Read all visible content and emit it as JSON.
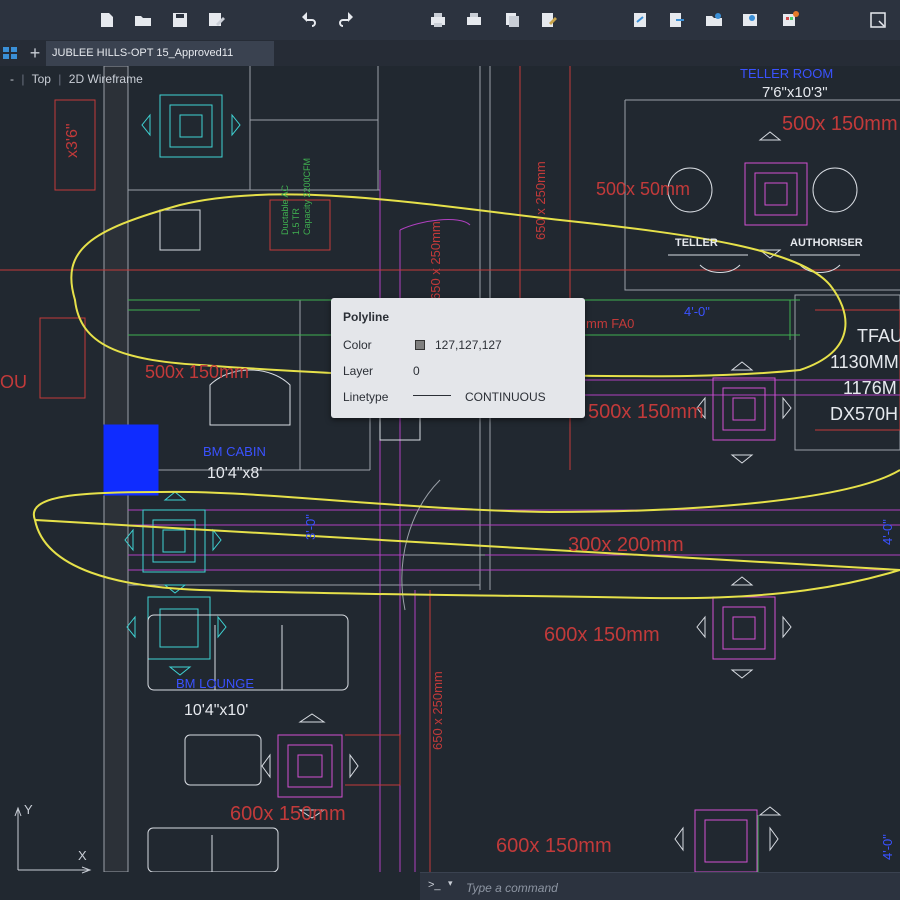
{
  "toolbar": {
    "left_icons": [
      "new-file-icon",
      "open-folder-icon",
      "save-icon",
      "save-as-icon",
      "undo-icon",
      "redo-icon",
      "plot-icon",
      "batch-plot-icon",
      "publish-icon",
      "sheet-set-icon"
    ],
    "right_icons": [
      "share-icon",
      "export-icon",
      "collaborate-icon",
      "cloud-icon",
      "app-icon",
      "viewport-icon"
    ]
  },
  "tabs": [
    {
      "label": "JUBLEE HILLS-OPT 15_Approved11"
    }
  ],
  "viewcube": {
    "minus": "-",
    "view": "Top",
    "style": "2D Wireframe"
  },
  "drawing": {
    "room_labels": [
      {
        "text": "TELLER ROOM"
      },
      {
        "text": "7'6\"x10'3\""
      },
      {
        "text": "TELLER"
      },
      {
        "text": "AUTHORISER"
      },
      {
        "text": "BM CABIN"
      },
      {
        "text": "10'4\"x8'"
      },
      {
        "text": "BM LOUNGE"
      },
      {
        "text": "10'4\"x10'"
      }
    ],
    "duct_labels": [
      {
        "text": "500x  150mm"
      },
      {
        "text": "500x  50mm"
      },
      {
        "text": "500x  150mm"
      },
      {
        "text": "500x  150mm"
      },
      {
        "text": "300x  200mm"
      },
      {
        "text": "600x  150mm"
      },
      {
        "text": "600x  150mm"
      },
      {
        "text": "600x  150mm"
      },
      {
        "text": "650 x 250mm"
      },
      {
        "text": "650 x 250mm"
      },
      {
        "text": "650 x 250mm"
      }
    ],
    "equipment_labels": [
      {
        "text": "TFAU"
      },
      {
        "text": "1130MM"
      },
      {
        "text": "1176M"
      },
      {
        "text": "DX570H"
      },
      {
        "text": "mm  FA0"
      },
      {
        "text": "Ductable AC"
      },
      {
        "text": "1.5 TR"
      },
      {
        "text": "Capacity 2200CFM"
      }
    ],
    "misc_labels": [
      {
        "text": "OU"
      },
      {
        "text": "x3'6\""
      },
      {
        "text": "4'-0\""
      },
      {
        "text": "3'-0\""
      },
      {
        "text": "4'-0\""
      },
      {
        "text": "4'-0\""
      }
    ]
  },
  "tooltip": {
    "title": "Polyline",
    "rows": [
      {
        "label": "Color",
        "value": "127,127,127"
      },
      {
        "label": "Layer",
        "value": "0"
      },
      {
        "label": "Linetype",
        "value": "CONTINUOUS"
      }
    ],
    "color_swatch": "#7f7f7f"
  },
  "command_line": {
    "prompt": ">_",
    "placeholder": "Type a command"
  },
  "ucs": {
    "x": "X",
    "y": "Y"
  },
  "colors": {
    "background": "#212830",
    "duct_red": "#c23a3a",
    "diffuser_magenta": "#d24fd2",
    "diffuser_cyan": "#3fd3d3",
    "markup_yellow": "#e6e14a",
    "text_blue": "#3a52ff",
    "wall_gray": "#9aa0a8"
  }
}
